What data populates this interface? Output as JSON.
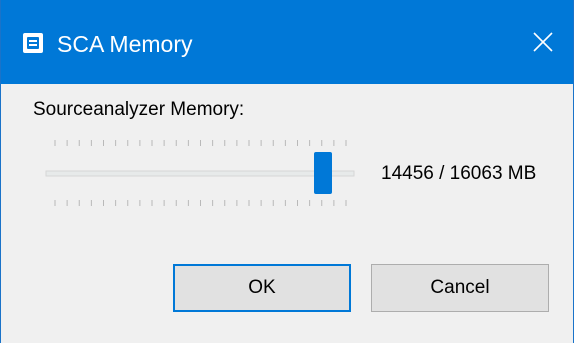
{
  "window": {
    "title": "SCA Memory",
    "app_icon": "sca-app-icon",
    "close_icon": "close-icon"
  },
  "memory": {
    "label": "Sourceanalyzer Memory:",
    "readout": "14456 / 16063 MB",
    "slider_fraction": 0.9,
    "slider_max_mb": 16063,
    "slider_value_mb": 14456
  },
  "buttons": {
    "ok_label": "OK",
    "cancel_label": "Cancel"
  },
  "colors": {
    "accent": "#0078d7",
    "title_text": "#ffffff",
    "dialog_bg": "#f0f0f0",
    "button_bg": "#e1e1e1"
  }
}
